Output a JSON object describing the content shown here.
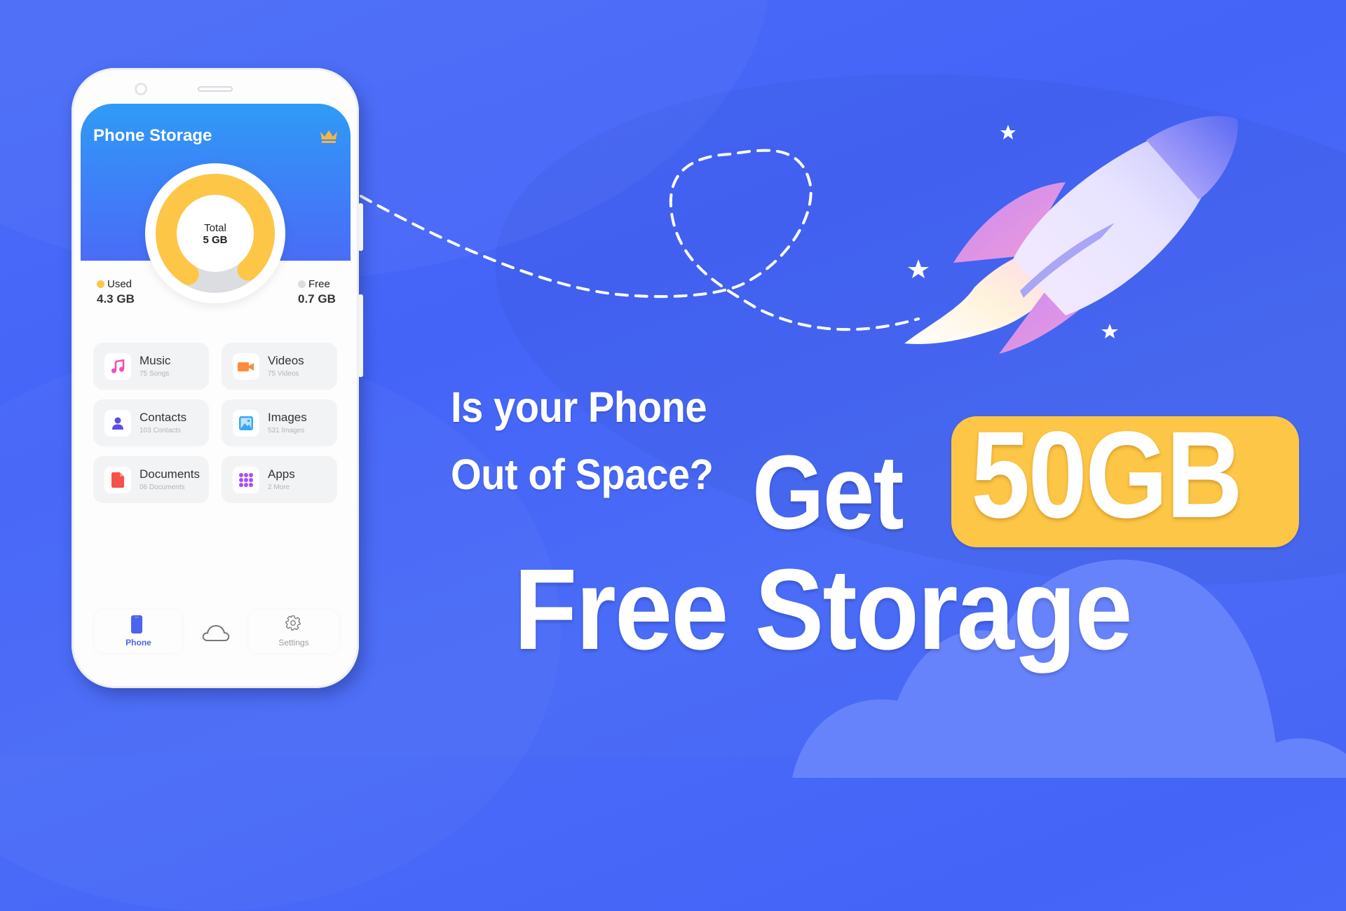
{
  "phone": {
    "app_title": "Phone Storage",
    "header_icon": "crown-icon",
    "storage": {
      "total_label": "Total",
      "total_value": "5 GB",
      "used_label": "Used",
      "used_value": "4.3 GB",
      "free_label": "Free",
      "free_value": "0.7 GB",
      "used_fraction": 0.86,
      "used_color": "#fdc646",
      "free_color": "#dcdde1"
    },
    "categories": [
      {
        "label": "Music",
        "sub": "75 Songs",
        "icon": "music-note-icon",
        "color": "#f04fc2"
      },
      {
        "label": "Videos",
        "sub": "75 Videos",
        "icon": "video-camera-icon",
        "color": "#ff8a3d"
      },
      {
        "label": "Contacts",
        "sub": "103 Contacts",
        "icon": "person-icon",
        "color": "#5b4de8"
      },
      {
        "label": "Images",
        "sub": "531 Images",
        "icon": "image-icon",
        "color": "#3aa7f5"
      },
      {
        "label": "Documents",
        "sub": "06 Documents",
        "icon": "document-icon",
        "color": "#f5504a"
      },
      {
        "label": "Apps",
        "sub": "2 More",
        "icon": "apps-grid-icon",
        "color": "#a94df2"
      }
    ],
    "bottom_nav": [
      {
        "label": "Phone",
        "icon": "phone-icon",
        "active": true
      },
      {
        "label": "",
        "icon": "cloud-icon",
        "active": false
      },
      {
        "label": "Settings",
        "icon": "gear-icon",
        "active": false
      }
    ],
    "accent": "#4a64ee"
  },
  "headline": {
    "question_line1": "Is your Phone",
    "question_line2": "Out of Space?",
    "get": "Get",
    "amount": "50GB",
    "free_storage": "Free Storage",
    "badge_color": "#fdc646"
  },
  "background_color": "#4a6cf7"
}
